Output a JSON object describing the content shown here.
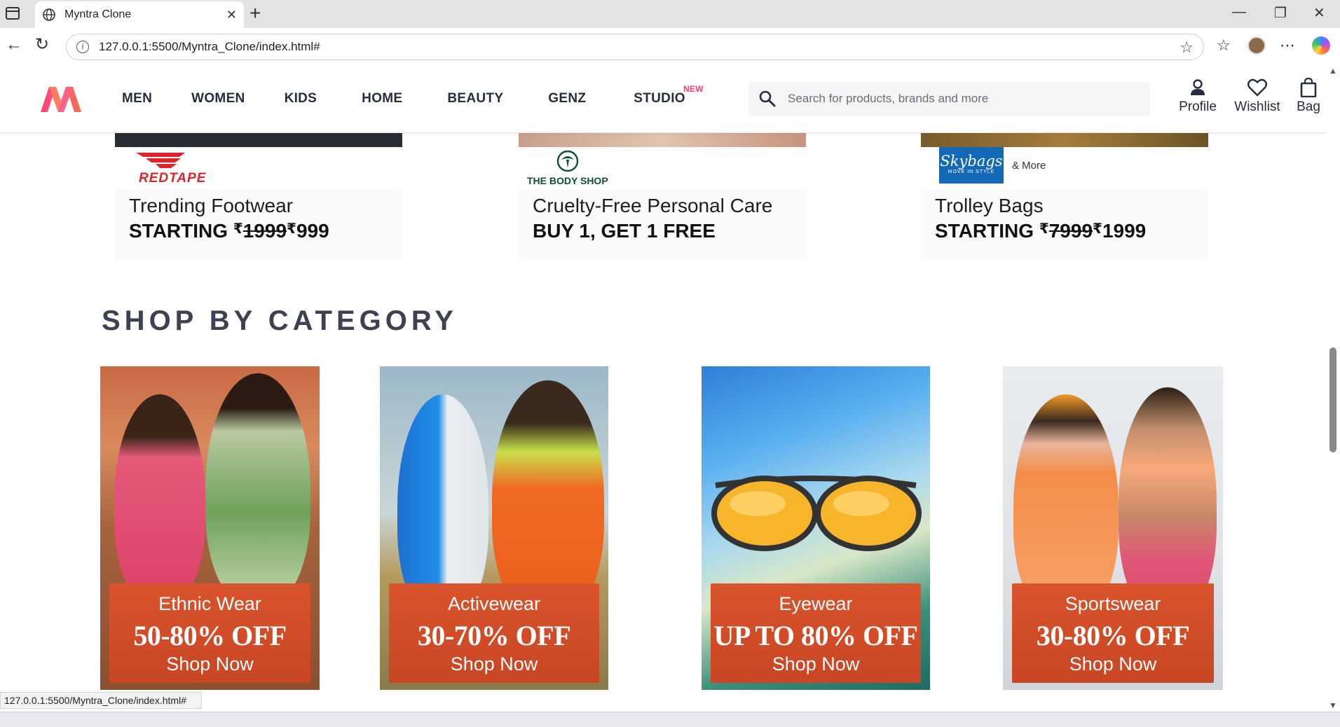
{
  "browser": {
    "tab_title": "Myntra Clone",
    "url": "127.0.0.1:5500/Myntra_Clone/index.html#",
    "status_url": "127.0.0.1:5500/Myntra_Clone/index.html#"
  },
  "header": {
    "nav": [
      {
        "label": "MEN"
      },
      {
        "label": "WOMEN"
      },
      {
        "label": "KIDS"
      },
      {
        "label": "HOME"
      },
      {
        "label": "BEAUTY"
      },
      {
        "label": "GENZ"
      },
      {
        "label": "STUDIO",
        "badge": "NEW"
      }
    ],
    "search_placeholder": "Search for products, brands and more",
    "actions": [
      {
        "label": "Profile",
        "icon": "profile-icon"
      },
      {
        "label": "Wishlist",
        "icon": "heart-icon"
      },
      {
        "label": "Bag",
        "icon": "bag-icon"
      }
    ],
    "brand_color": "#ff3f6c"
  },
  "brand_banners": [
    {
      "brand": "REDTAPE",
      "title": "Trending Footwear",
      "offer_prefix": "STARTING ",
      "currency": "₹",
      "old_price": "1999",
      "new_price": "999"
    },
    {
      "brand": "THE BODY SHOP",
      "title": "Cruelty-Free Personal Care",
      "offer": "BUY 1, GET 1 FREE"
    },
    {
      "brand": "Skybags",
      "brand_tagline": "MOVE IN STYLE",
      "extra": "& More",
      "title": "Trolley Bags",
      "offer_prefix": "STARTING ",
      "currency": "₹",
      "old_price": "7999",
      "new_price": "1999"
    }
  ],
  "section_title": "SHOP BY CATEGORY",
  "categories": [
    {
      "name": "Ethnic Wear",
      "discount": "50-80% OFF",
      "cta": "Shop Now"
    },
    {
      "name": "Activewear",
      "discount": "30-70% OFF",
      "cta": "Shop Now"
    },
    {
      "name": "Eyewear",
      "discount": "UP TO 80% OFF",
      "cta": "Shop Now"
    },
    {
      "name": "Sportswear",
      "discount": "30-80% OFF",
      "cta": "Shop Now"
    }
  ]
}
